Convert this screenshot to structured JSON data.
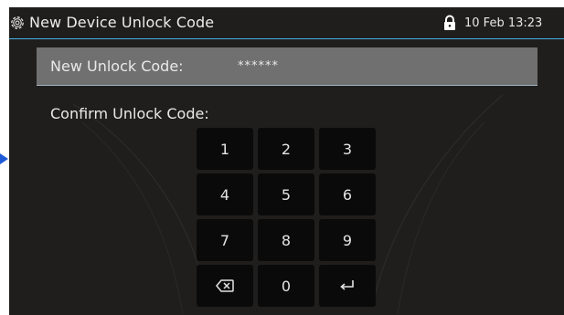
{
  "header": {
    "title": "New Device Unlock Code",
    "datetime": "10 Feb 13:23",
    "settings_icon": "gear-icon",
    "lock_icon": "lock-icon"
  },
  "fields": [
    {
      "label": "New Unlock Code:",
      "value": "******",
      "selected": true
    },
    {
      "label": "Confirm Unlock Code:",
      "value": "",
      "selected": false
    }
  ],
  "keypad": {
    "keys": [
      {
        "id": "1",
        "label": "1"
      },
      {
        "id": "2",
        "label": "2"
      },
      {
        "id": "3",
        "label": "3"
      },
      {
        "id": "4",
        "label": "4"
      },
      {
        "id": "5",
        "label": "5"
      },
      {
        "id": "6",
        "label": "6"
      },
      {
        "id": "7",
        "label": "7"
      },
      {
        "id": "8",
        "label": "8"
      },
      {
        "id": "9",
        "label": "9"
      },
      {
        "id": "backspace",
        "label": "",
        "icon": "backspace-icon"
      },
      {
        "id": "0",
        "label": "0"
      },
      {
        "id": "enter",
        "label": "",
        "icon": "enter-icon"
      }
    ]
  },
  "colors": {
    "screen_bg": "#1f1e1d",
    "accent": "#4ab0e4",
    "selected_row": "#707070",
    "key_bg": "#0b0a0a",
    "pointer": "#1e5bd8"
  }
}
